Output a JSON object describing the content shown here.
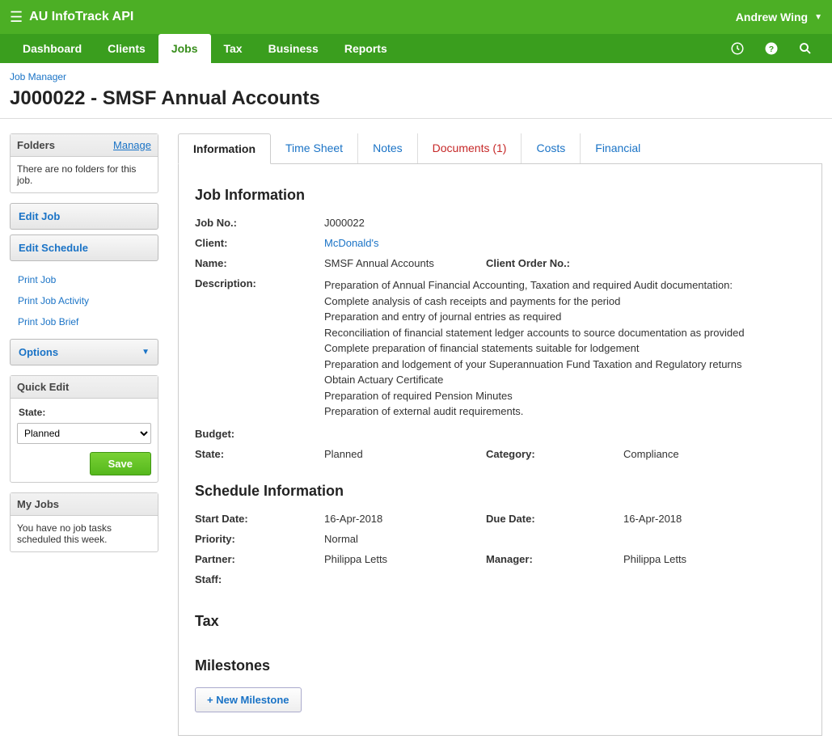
{
  "header": {
    "app_title": "AU InfoTrack API",
    "user_name": "Andrew Wing"
  },
  "nav": {
    "items": [
      "Dashboard",
      "Clients",
      "Jobs",
      "Tax",
      "Business",
      "Reports"
    ],
    "active_index": 2
  },
  "breadcrumb": {
    "parent": "Job Manager"
  },
  "page_title": "J000022 - SMSF Annual Accounts",
  "sidebar": {
    "folders_title": "Folders",
    "folders_manage": "Manage",
    "folders_empty": "There are no folders for this job.",
    "edit_job": "Edit Job",
    "edit_schedule": "Edit Schedule",
    "print_links": [
      "Print Job",
      "Print Job Activity",
      "Print Job Brief"
    ],
    "options_label": "Options",
    "quick_edit_title": "Quick Edit",
    "state_label": "State:",
    "state_value": "Planned",
    "save_label": "Save",
    "my_jobs_title": "My Jobs",
    "my_jobs_text": "You have no job tasks scheduled this week."
  },
  "tabs": [
    "Information",
    "Time Sheet",
    "Notes",
    "Documents (1)",
    "Costs",
    "Financial"
  ],
  "tabs_active_index": 0,
  "tabs_red_index": 3,
  "content": {
    "job_info_title": "Job Information",
    "job_no_label": "Job No.:",
    "job_no_value": "J000022",
    "client_label": "Client:",
    "client_value": "McDonald's",
    "name_label": "Name:",
    "name_value": "SMSF Annual Accounts",
    "client_order_label": "Client Order No.:",
    "client_order_value": "",
    "description_label": "Description:",
    "description_value": "Preparation of Annual Financial Accounting, Taxation and required Audit documentation:\nComplete analysis of cash receipts and payments for the period\nPreparation and entry of journal entries as required\nReconciliation of financial statement ledger accounts to source documentation as provided\nComplete preparation of financial statements suitable for lodgement\nPreparation and lodgement of your Superannuation Fund Taxation and Regulatory returns\nObtain Actuary Certificate\nPreparation of required Pension Minutes\nPreparation of external audit requirements.",
    "budget_label": "Budget:",
    "budget_value": "",
    "state_label": "State:",
    "state_value": "Planned",
    "category_label": "Category:",
    "category_value": "Compliance",
    "schedule_title": "Schedule Information",
    "start_date_label": "Start Date:",
    "start_date_value": "16-Apr-2018",
    "due_date_label": "Due Date:",
    "due_date_value": "16-Apr-2018",
    "priority_label": "Priority:",
    "priority_value": "Normal",
    "partner_label": "Partner:",
    "partner_value": "Philippa Letts",
    "manager_label": "Manager:",
    "manager_value": "Philippa Letts",
    "staff_label": "Staff:",
    "staff_value": "",
    "tax_title": "Tax",
    "milestones_title": "Milestones",
    "new_milestone_label": "+ New Milestone"
  }
}
